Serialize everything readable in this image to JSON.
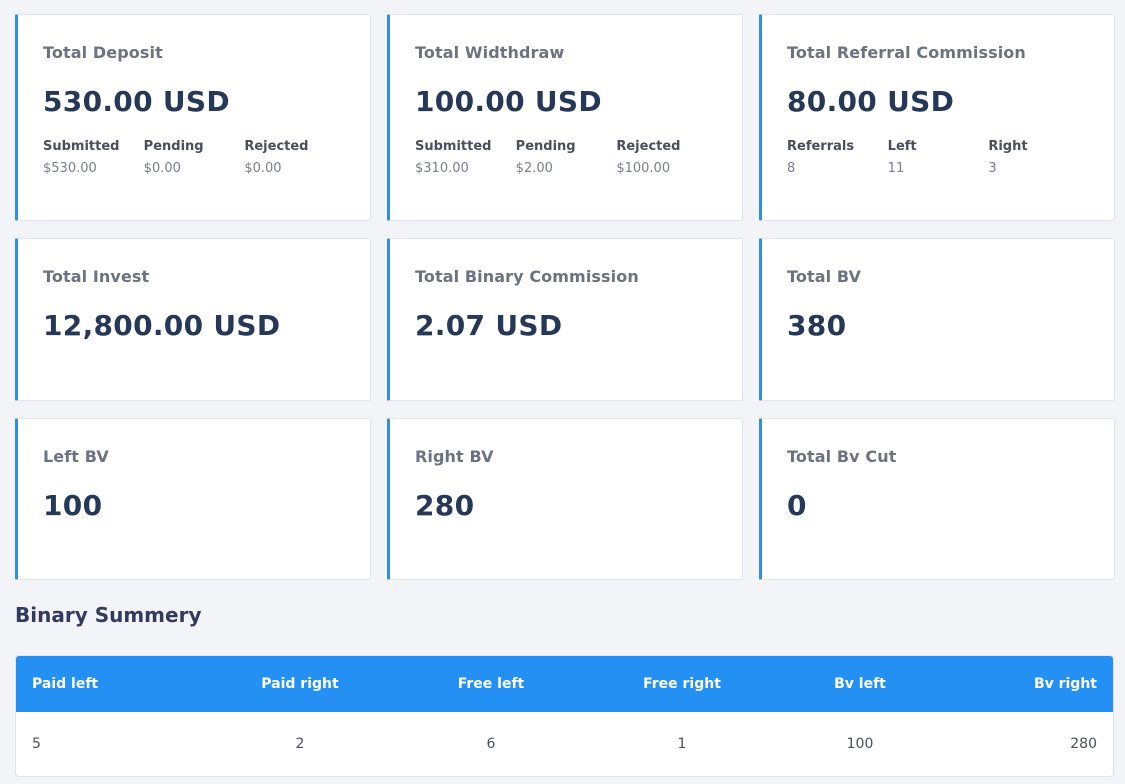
{
  "cards": [
    {
      "title": "Total Deposit",
      "value": "530.00 USD",
      "stats": [
        {
          "label": "Submitted",
          "value": "$530.00"
        },
        {
          "label": "Pending",
          "value": "$0.00"
        },
        {
          "label": "Rejected",
          "value": "$0.00"
        }
      ]
    },
    {
      "title": "Total Widthdraw",
      "value": "100.00 USD",
      "stats": [
        {
          "label": "Submitted",
          "value": "$310.00"
        },
        {
          "label": "Pending",
          "value": "$2.00"
        },
        {
          "label": "Rejected",
          "value": "$100.00"
        }
      ]
    },
    {
      "title": "Total Referral Commission",
      "value": "80.00 USD",
      "stats": [
        {
          "label": "Referrals",
          "value": "8"
        },
        {
          "label": "Left",
          "value": "11"
        },
        {
          "label": "Right",
          "value": "3"
        }
      ]
    },
    {
      "title": "Total Invest",
      "value": "12,800.00 USD"
    },
    {
      "title": "Total Binary Commission",
      "value": "2.07 USD"
    },
    {
      "title": "Total BV",
      "value": "380"
    },
    {
      "title": "Left BV",
      "value": "100"
    },
    {
      "title": "Right BV",
      "value": "280"
    },
    {
      "title": "Total Bv Cut",
      "value": "0"
    }
  ],
  "binary_summary": {
    "title": "Binary Summery",
    "columns": [
      "Paid left",
      "Paid right",
      "Free left",
      "Free right",
      "Bv left",
      "Bv right"
    ],
    "rows": [
      [
        "5",
        "2",
        "6",
        "1",
        "100",
        "280"
      ]
    ]
  },
  "colors": {
    "accent": "#2e8ee8",
    "table_header": "#2590f4",
    "background": "#f3f4f8"
  }
}
